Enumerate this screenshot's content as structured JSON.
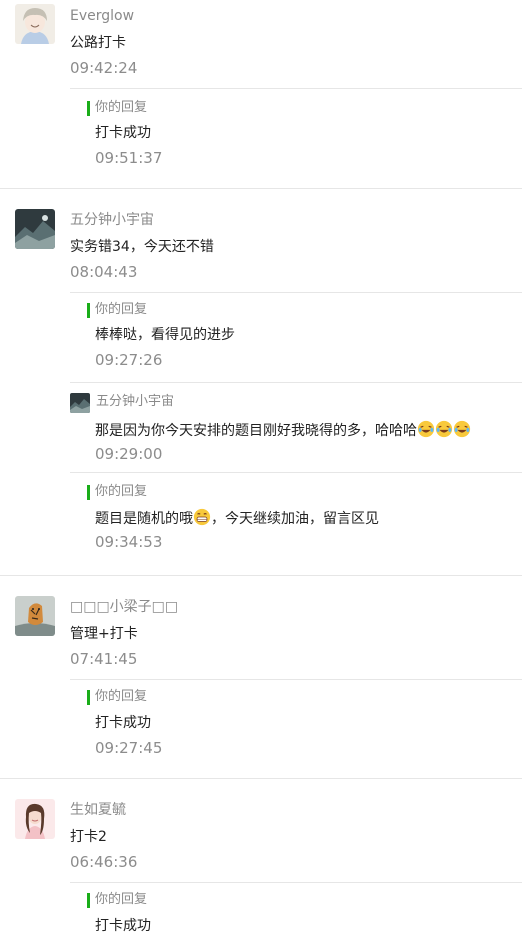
{
  "comments": [
    {
      "author": "Everglow",
      "text": "公路打卡",
      "time": "09:42:24",
      "avatar": "anime-boy-avatar",
      "replies": [
        {
          "label": "你的回复",
          "text": "打卡成功",
          "time": "09:51:37"
        }
      ]
    },
    {
      "author": "五分钟小宇宙",
      "text": "实务错34，今天还不错",
      "time": "08:04:43",
      "avatar": "landscape-avatar",
      "replies": [
        {
          "label": "你的回复",
          "text": "棒棒哒，看得见的进步",
          "time": "09:27:26"
        },
        {
          "author": "五分钟小宇宙",
          "text": "那是因为你今天安排的题目刚好我晓得的多，哈哈哈",
          "time": "09:29:00",
          "emoji": "laughing-tears-emoji"
        },
        {
          "label": "你的回复",
          "text_before": "题目是随机的哦",
          "text_after": "，今天继续加油，留言区见",
          "time": "09:34:53",
          "emoji": "grinning-emoji"
        }
      ]
    },
    {
      "author": "□□□小梁子□□",
      "text": "管理+打卡",
      "time": "07:41:45",
      "avatar": "tiger-avatar",
      "replies": [
        {
          "label": "你的回复",
          "text": "打卡成功",
          "time": "09:27:45"
        }
      ]
    },
    {
      "author": "生如夏毓",
      "text": "打卡2",
      "time": "06:46:36",
      "avatar": "girl-illustration-avatar",
      "replies": [
        {
          "label": "你的回复",
          "text": "打卡成功"
        }
      ]
    }
  ],
  "colors": {
    "accent": "#1aad19",
    "name": "#8a8a8a",
    "time": "#8c8c8c",
    "divider": "#e6e6e6"
  }
}
